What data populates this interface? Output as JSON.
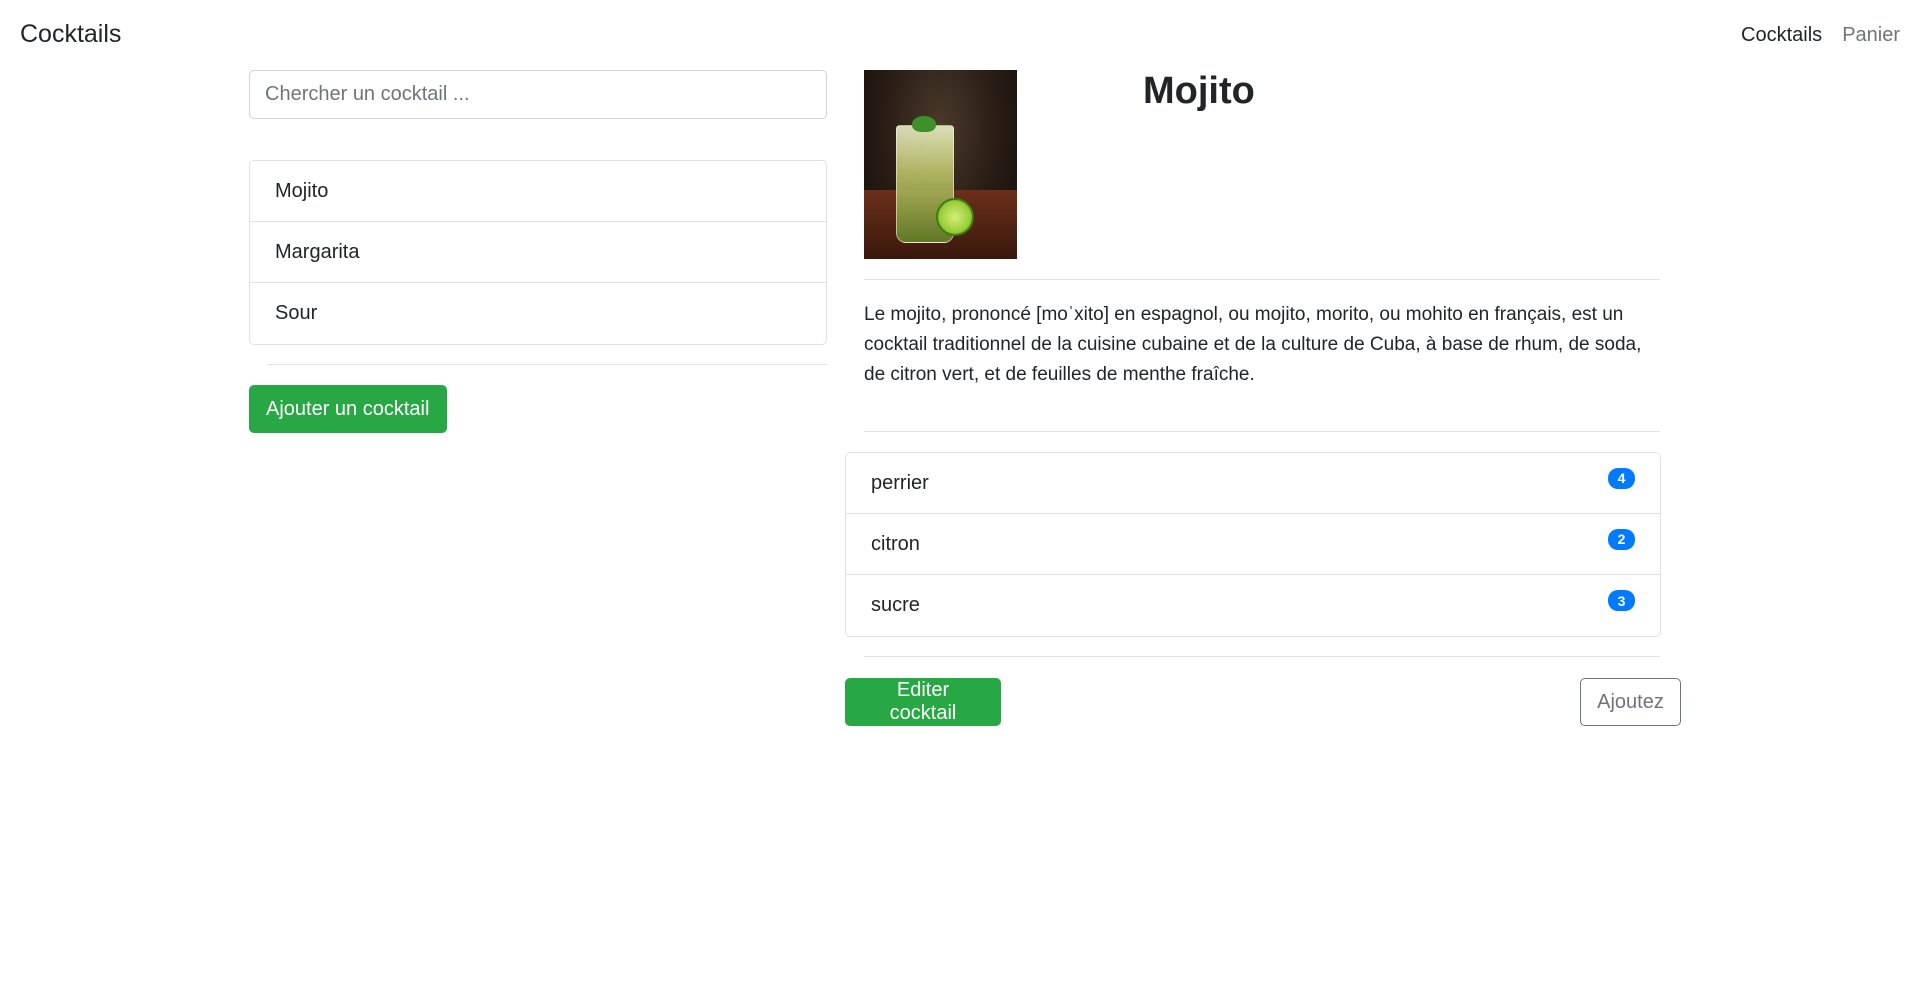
{
  "navbar": {
    "brand": "Cocktails",
    "links": [
      {
        "label": "Cocktails",
        "active": true
      },
      {
        "label": "Panier",
        "active": false
      }
    ]
  },
  "search": {
    "placeholder": "Chercher un cocktail ...",
    "value": ""
  },
  "cocktail_list": {
    "items": [
      {
        "label": "Mojito"
      },
      {
        "label": "Margarita"
      },
      {
        "label": "Sour"
      }
    ],
    "add_button_label": "Ajouter un cocktail"
  },
  "detail": {
    "title": "Mojito",
    "image_description": "mojito-glass-photo",
    "description": "Le mojito, prononcé [moˈxito] en espagnol, ou mojito, morito, ou mohito en français, est un cocktail traditionnel de la cuisine cubaine et de la culture de Cuba, à base de rhum, de soda, de citron vert, et de feuilles de menthe fraîche.",
    "ingredients": [
      {
        "name": "perrier",
        "quantity": "4"
      },
      {
        "name": "citron",
        "quantity": "2"
      },
      {
        "name": "sucre",
        "quantity": "3"
      }
    ],
    "edit_button_label": "Editer cocktail",
    "add_cart_button_label": "Ajoutez"
  },
  "colors": {
    "success": "#28a745",
    "badge": "#007bff",
    "secondary": "#6c757d"
  }
}
